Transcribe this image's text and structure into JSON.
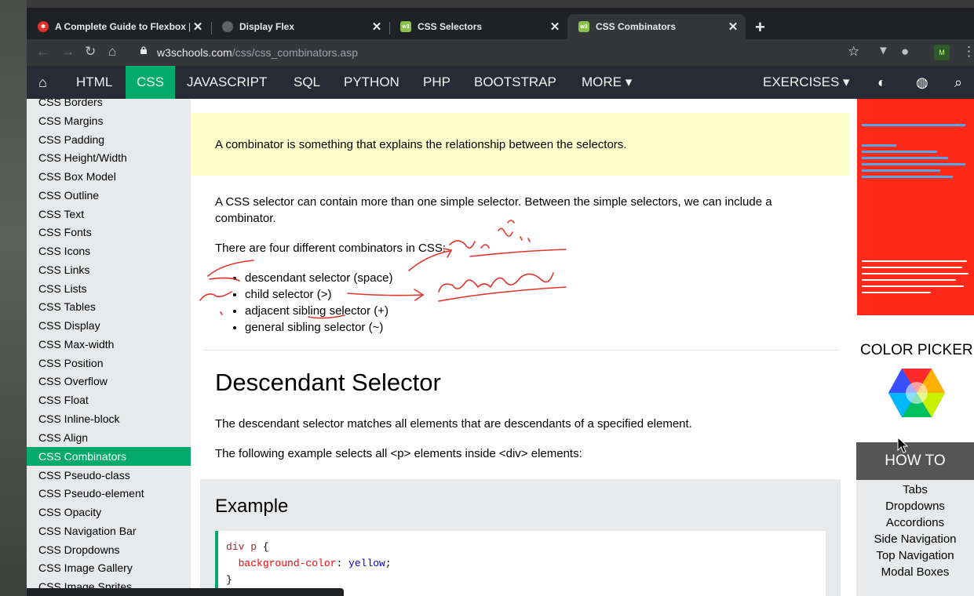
{
  "browser": {
    "tabs": [
      {
        "title": "A Complete Guide to Flexbox |",
        "favicon": "css-tricks-icon",
        "color": "#e0312a"
      },
      {
        "title": "Display Flex",
        "favicon": "globe-icon",
        "color": "#5f6368"
      },
      {
        "title": "CSS Selectors",
        "favicon": "w3schools-icon",
        "color": "#8bc34a"
      },
      {
        "title": "CSS Combinators",
        "favicon": "w3schools-icon",
        "color": "#8bc34a"
      }
    ],
    "url_host": "w3schools.com",
    "url_path": "/css/css_combinators.asp"
  },
  "nav": {
    "items": [
      "HTML",
      "CSS",
      "JAVASCRIPT",
      "SQL",
      "PYTHON",
      "PHP",
      "BOOTSTRAP",
      "MORE ▾"
    ],
    "exercises": "EXERCISES ▾"
  },
  "sidebar": {
    "items": [
      "CSS Borders",
      "CSS Margins",
      "CSS Padding",
      "CSS Height/Width",
      "CSS Box Model",
      "CSS Outline",
      "CSS Text",
      "CSS Fonts",
      "CSS Icons",
      "CSS Links",
      "CSS Lists",
      "CSS Tables",
      "CSS Display",
      "CSS Max-width",
      "CSS Position",
      "CSS Overflow",
      "CSS Float",
      "CSS Inline-block",
      "CSS Align",
      "CSS Combinators",
      "CSS Pseudo-class",
      "CSS Pseudo-element",
      "CSS Opacity",
      "CSS Navigation Bar",
      "CSS Dropdowns",
      "CSS Image Gallery",
      "CSS Image Sprites"
    ],
    "active": "CSS Combinators"
  },
  "main": {
    "note": "A combinator is something that explains the relationship between the selectors.",
    "intro": "A CSS selector can contain more than one simple selector. Between the simple selectors, we can include a combinator.",
    "four": "There are four different combinators in CSS:",
    "combinators": [
      "descendant selector (space)",
      "child selector (>)",
      "adjacent sibling selector (+)",
      "general sibling selector (~)"
    ],
    "section_title": "Descendant Selector",
    "desc1": "The descendant selector matches all elements that are descendants of a specified element.",
    "desc2": "The following example selects all <p> elements inside <div> elements:",
    "example_title": "Example",
    "code": {
      "line1_sel": "div p",
      "line1_brace": " {",
      "prop": "background-color",
      "colon": ": ",
      "val": "yellow",
      "semi": ";",
      "close": "}"
    }
  },
  "right": {
    "color_picker": "COLOR PICKER",
    "howto_title": "HOW TO",
    "howto_items": [
      "Tabs",
      "Dropdowns",
      "Accordions",
      "Side Navigation",
      "Top Navigation",
      "Modal Boxes"
    ]
  },
  "colors": {
    "brand_green": "#04aa6d",
    "nav_dark": "#282a35",
    "ad_red": "#ff2a1a",
    "note_yellow": "#ffffcc"
  }
}
